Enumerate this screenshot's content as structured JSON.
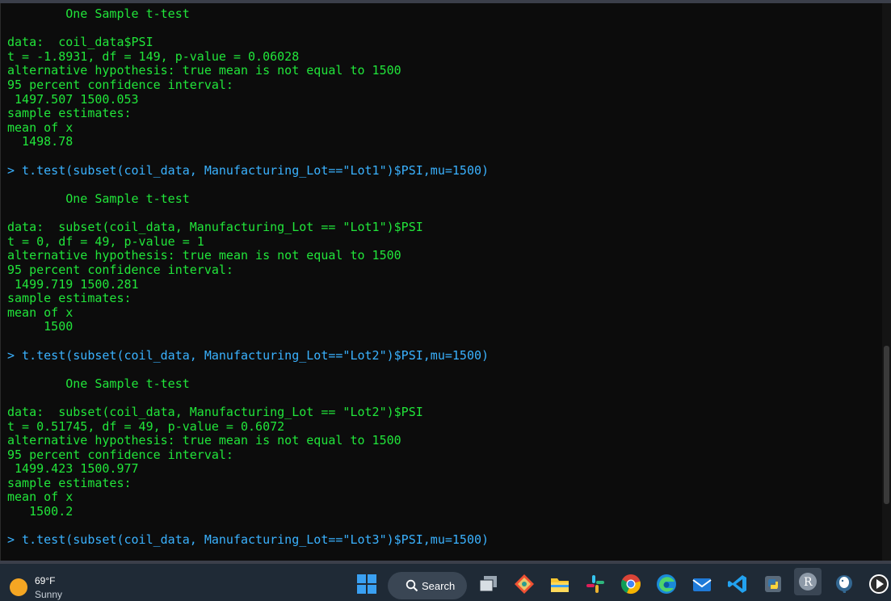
{
  "console": {
    "lines": [
      {
        "text": "        One Sample t-test",
        "type": "output"
      },
      {
        "text": "data:  coil_data$PSI",
        "type": "output"
      },
      {
        "text": "t = -1.8931, df = 149, p-value = 0.06028",
        "type": "output"
      },
      {
        "text": "alternative hypothesis: true mean is not equal to 1500",
        "type": "output"
      },
      {
        "text": "95 percent confidence interval:",
        "type": "output"
      },
      {
        "text": " 1497.507 1500.053",
        "type": "output"
      },
      {
        "text": "sample estimates:",
        "type": "output"
      },
      {
        "text": "mean of x",
        "type": "output"
      },
      {
        "text": "  1498.78",
        "type": "output"
      },
      {
        "text": "> t.test(subset(coil_data, Manufacturing_Lot==\"Lot1\")$PSI,mu=1500)",
        "type": "command"
      },
      {
        "text": "        One Sample t-test",
        "type": "output"
      },
      {
        "text": "data:  subset(coil_data, Manufacturing_Lot == \"Lot1\")$PSI",
        "type": "output"
      },
      {
        "text": "t = 0, df = 49, p-value = 1",
        "type": "output"
      },
      {
        "text": "alternative hypothesis: true mean is not equal to 1500",
        "type": "output"
      },
      {
        "text": "95 percent confidence interval:",
        "type": "output"
      },
      {
        "text": " 1499.719 1500.281",
        "type": "output"
      },
      {
        "text": "sample estimates:",
        "type": "output"
      },
      {
        "text": "mean of x",
        "type": "output"
      },
      {
        "text": "     1500",
        "type": "output"
      },
      {
        "text": "> t.test(subset(coil_data, Manufacturing_Lot==\"Lot2\")$PSI,mu=1500)",
        "type": "command"
      },
      {
        "text": "        One Sample t-test",
        "type": "output"
      },
      {
        "text": "data:  subset(coil_data, Manufacturing_Lot == \"Lot2\")$PSI",
        "type": "output"
      },
      {
        "text": "t = 0.51745, df = 49, p-value = 0.6072",
        "type": "output"
      },
      {
        "text": "alternative hypothesis: true mean is not equal to 1500",
        "type": "output"
      },
      {
        "text": "95 percent confidence interval:",
        "type": "output"
      },
      {
        "text": " 1499.423 1500.977",
        "type": "output"
      },
      {
        "text": "sample estimates:",
        "type": "output"
      },
      {
        "text": "mean of x",
        "type": "output"
      },
      {
        "text": "   1500.2",
        "type": "output"
      },
      {
        "text": "> t.test(subset(coil_data, Manufacturing_Lot==\"Lot3\")$PSI,mu=1500)",
        "type": "command"
      }
    ]
  },
  "taskbar": {
    "weather": {
      "temperature": "69°F",
      "condition": "Sunny"
    },
    "search_label": "Search",
    "apps": [
      {
        "name": "start-icon"
      },
      {
        "name": "task-view-icon"
      },
      {
        "name": "git-icon"
      },
      {
        "name": "file-explorer-icon"
      },
      {
        "name": "slack-icon"
      },
      {
        "name": "chrome-icon"
      },
      {
        "name": "edge-icon"
      },
      {
        "name": "mail-icon"
      },
      {
        "name": "vscode-icon"
      },
      {
        "name": "python-icon"
      },
      {
        "name": "r-icon"
      },
      {
        "name": "postgresql-icon"
      },
      {
        "name": "media-player-icon"
      }
    ]
  },
  "colors": {
    "output": "#21e53a",
    "command": "#3ab2ff",
    "background": "#0c0c0c",
    "taskbar": "#1f2a36"
  }
}
